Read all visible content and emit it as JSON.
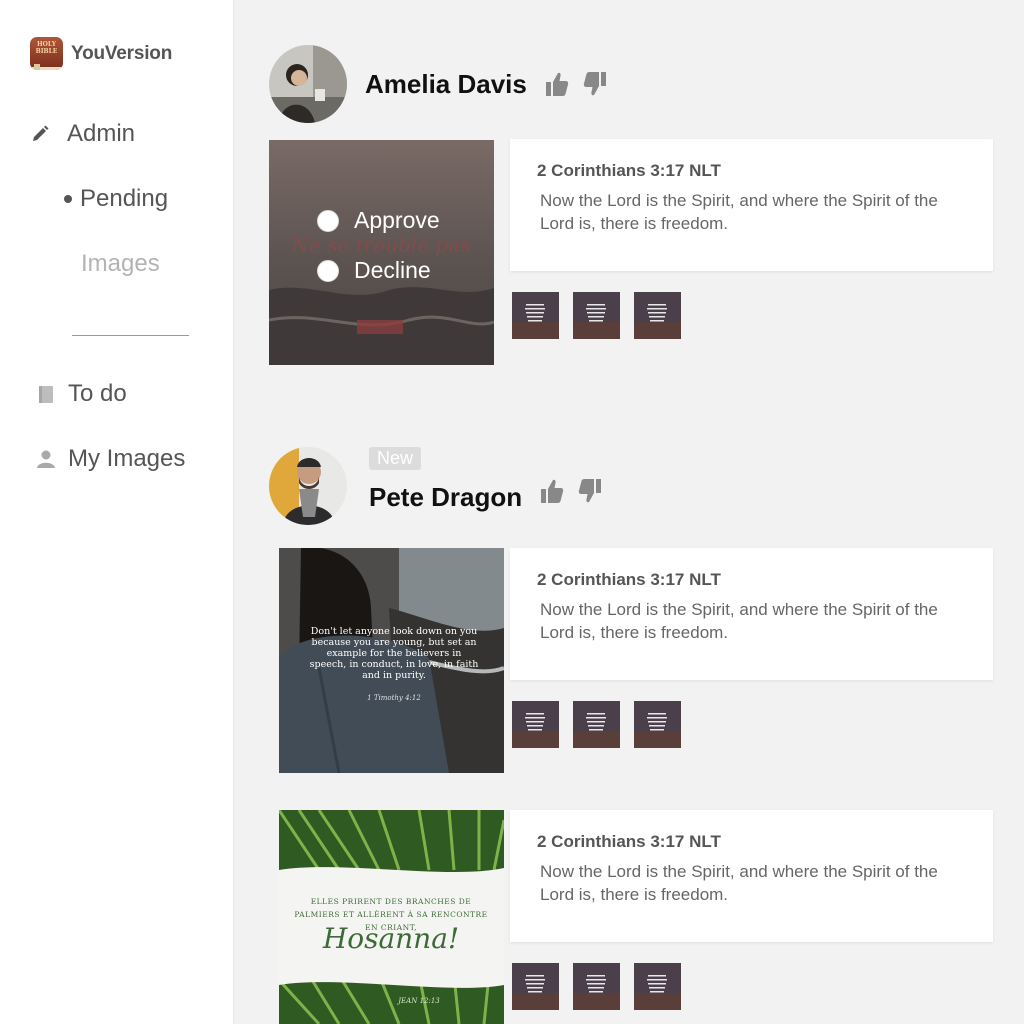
{
  "sidebar": {
    "brand": "YouVersion",
    "brand_logo_text": "HOLY BIBLE",
    "items": [
      {
        "label": "Admin",
        "icon": "pencil-icon"
      },
      {
        "label": "Pending",
        "icon": "bullet-icon"
      },
      {
        "label": "Images"
      },
      {
        "label": "To do",
        "icon": "book-icon"
      },
      {
        "label": "My Images",
        "icon": "person-icon"
      }
    ]
  },
  "posts": [
    {
      "user": "Amelia Davis",
      "badge": "",
      "options": [
        "Approve",
        "Decline"
      ],
      "image_text": "Ne se trouble pas",
      "verse_ref": "2 Corinthians 3:17 NLT",
      "verse_text": "Now the Lord is the Spirit, and where the Spirit of the Lord is, there is freedom."
    },
    {
      "user": "Pete Dragon",
      "badge": "New",
      "image_text": "Don't let anyone look down on you because you are young, but set an example for the believers in speech, in conduct, in love, in faith and in purity.",
      "image_ref": "1 Timothy 4:12",
      "verse_ref": "2 Corinthians 3:17 NLT",
      "verse_text": "Now the Lord is the Spirit, and where the Spirit of the Lord is, there is freedom."
    },
    {
      "image_text_top": "ELLES PRIRENT DES BRANCHES DE PALMIERS ET ALLÈRENT À SA RENCONTRE EN CRIANT,",
      "image_title": "Hosanna!",
      "image_ref": "JEAN 12:13",
      "verse_ref": "2 Corinthians 3:17 NLT",
      "verse_text": "Now the Lord is the Spirit, and where the Spirit of the Lord is, there is freedom."
    }
  ],
  "colors": {
    "accent_text": "#555555",
    "thumb_dark": "#3d3540"
  }
}
